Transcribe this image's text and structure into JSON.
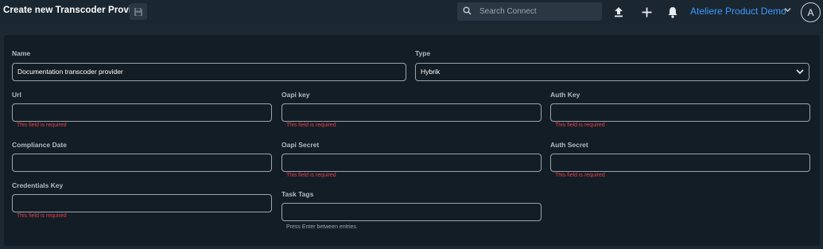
{
  "header": {
    "title": "Create new Transcoder Provider",
    "search_placeholder": "Search Connect",
    "org_name": "Ateliere Product Demo",
    "avatar_initial": "A",
    "icons": [
      "save-icon",
      "search-icon",
      "upload-icon",
      "plus-icon",
      "bell-icon",
      "chevron-down-icon"
    ]
  },
  "form": {
    "name": {
      "label": "Name",
      "value": "Documentation transcoder provider"
    },
    "type": {
      "label": "Type",
      "value": "Hybrik"
    },
    "url": {
      "label": "Url",
      "value": "",
      "error": "This field is required"
    },
    "oapi_key": {
      "label": "Oapi key",
      "value": "",
      "error": "This field is required"
    },
    "auth_key": {
      "label": "Auth Key",
      "value": "",
      "error": "This field is required"
    },
    "compliance_date": {
      "label": "Compliance Date",
      "value": ""
    },
    "oapi_secret": {
      "label": "Oapi Secret",
      "value": "",
      "error": "This field is required"
    },
    "auth_secret": {
      "label": "Auth Secret",
      "value": "",
      "error": "This field is required"
    },
    "credentials_key": {
      "label": "Credentials Key",
      "value": "",
      "error": "This field is required"
    },
    "task_tags": {
      "label": "Task Tags",
      "value": "",
      "help": "Press Enter between entries."
    }
  },
  "colors": {
    "accent": "#3d9bff",
    "error": "#e0414b",
    "panel": "#131d25",
    "background": "#1c2832"
  }
}
